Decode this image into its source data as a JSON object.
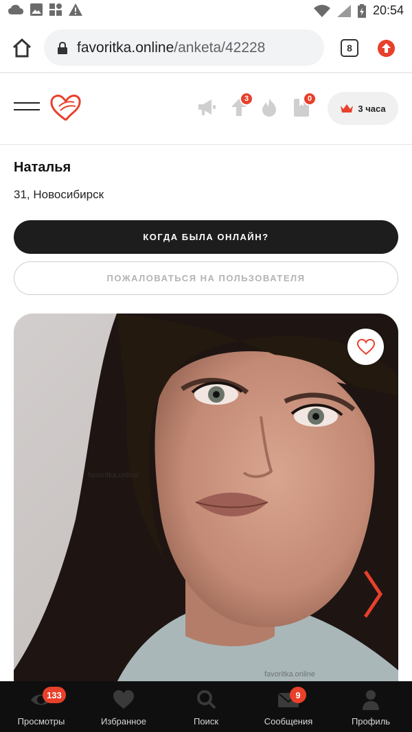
{
  "status_bar": {
    "time": "20:54",
    "left_icons": [
      "cloud-icon",
      "image-icon",
      "apps-icon",
      "warning-icon"
    ],
    "right_icons": [
      "wifi-icon",
      "signal-icon",
      "battery-charging-icon"
    ]
  },
  "browser": {
    "url_host": "favoritka.online",
    "url_path": "/anketa/42228",
    "tab_count": "8"
  },
  "site_header": {
    "lift_badge": "3",
    "bookmark_badge": "0",
    "premium_label": "3 часа",
    "colors": {
      "accent": "#e8402b",
      "premium_bg": "#f0f0f0"
    }
  },
  "profile": {
    "name": "Наталья",
    "age_city": "31, Новосибирск",
    "online_button": "КОГДА БЫЛА ОНЛАЙН?",
    "report_button": "ПОЖАЛОВАТЬСЯ НА ПОЛЬЗОВАТЕЛЯ",
    "photo_watermark": "favoritka.online"
  },
  "bottom_nav": {
    "items": [
      {
        "label": "Просмотры",
        "icon": "eye-icon",
        "badge": "133"
      },
      {
        "label": "Избранное",
        "icon": "heart-icon",
        "badge": ""
      },
      {
        "label": "Поиск",
        "icon": "search-icon",
        "badge": ""
      },
      {
        "label": "Сообщения",
        "icon": "envelope-icon",
        "badge": "9"
      },
      {
        "label": "Профиль",
        "icon": "user-icon",
        "badge": ""
      }
    ]
  }
}
